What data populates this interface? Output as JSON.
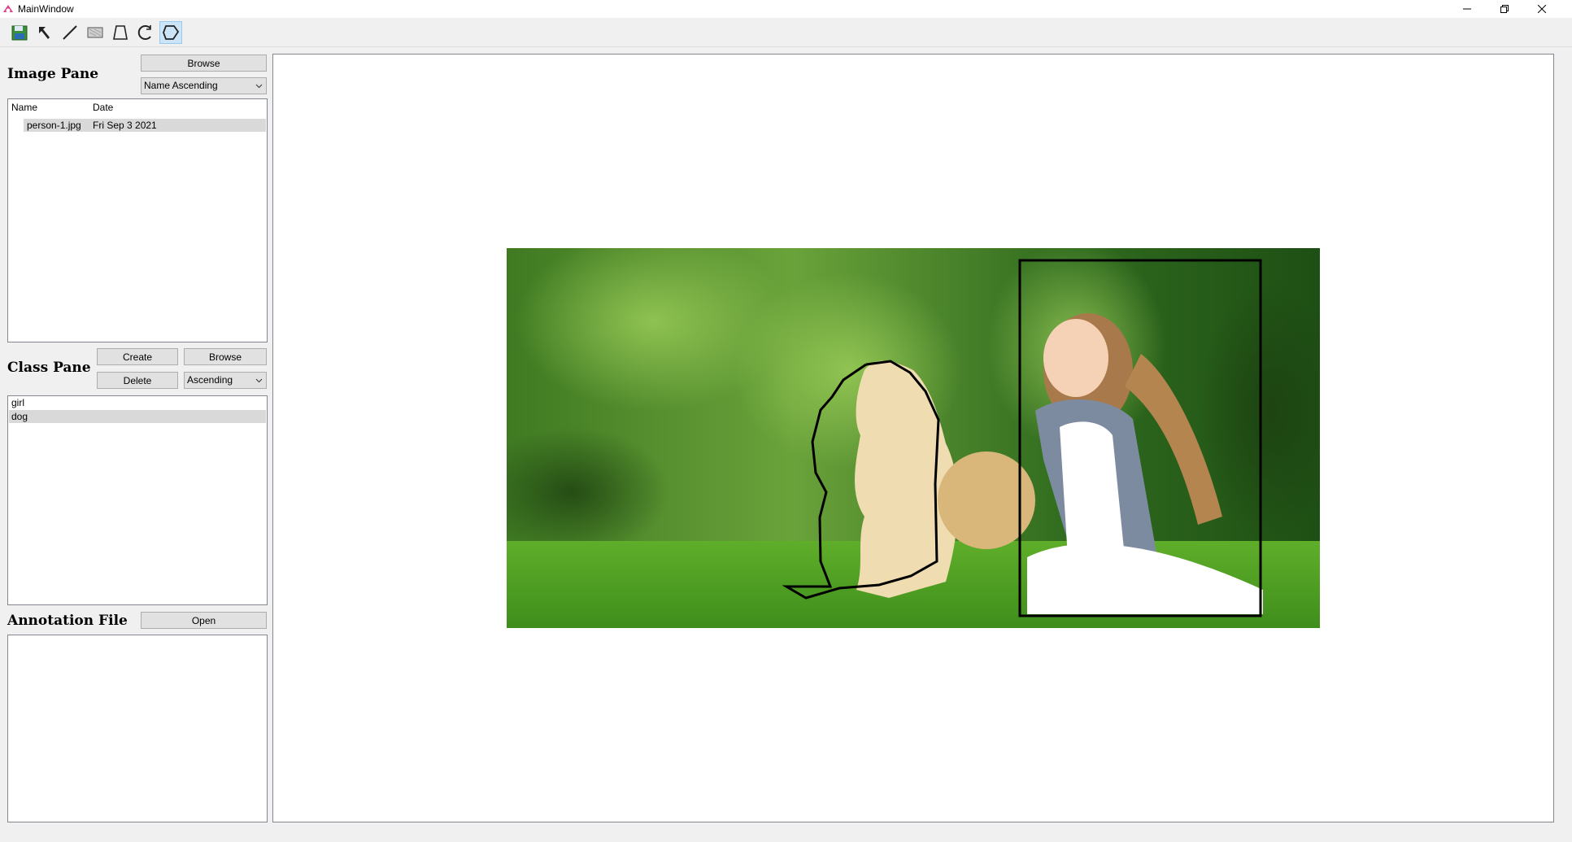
{
  "window": {
    "title": "MainWindow"
  },
  "toolbar": {
    "tools": [
      "save-icon",
      "select-arrow-icon",
      "line-icon",
      "rectangle-icon",
      "trapezoid-icon",
      "rotate-icon",
      "polygon-icon"
    ],
    "active_tool": "polygon-icon"
  },
  "image_pane": {
    "title": "Image Pane",
    "browse_label": "Browse",
    "sort_selected": "Name Ascending",
    "columns": [
      "Name",
      "Date"
    ],
    "rows": [
      {
        "name": "person-1.jpg",
        "date": "Fri Sep 3 2021",
        "selected": true
      }
    ]
  },
  "class_pane": {
    "title": "Class Pane",
    "create_label": "Create",
    "browse_label": "Browse",
    "delete_label": "Delete",
    "sort_selected": "Ascending",
    "items": [
      {
        "label": "girl",
        "selected": false
      },
      {
        "label": "dog",
        "selected": true
      }
    ]
  },
  "annotation_file": {
    "title": "Annotation File",
    "open_label": "Open"
  },
  "colors": {
    "selection": "#d9d9d9",
    "active_tool": "#cce4f7",
    "annotation_stroke": "#000000"
  }
}
